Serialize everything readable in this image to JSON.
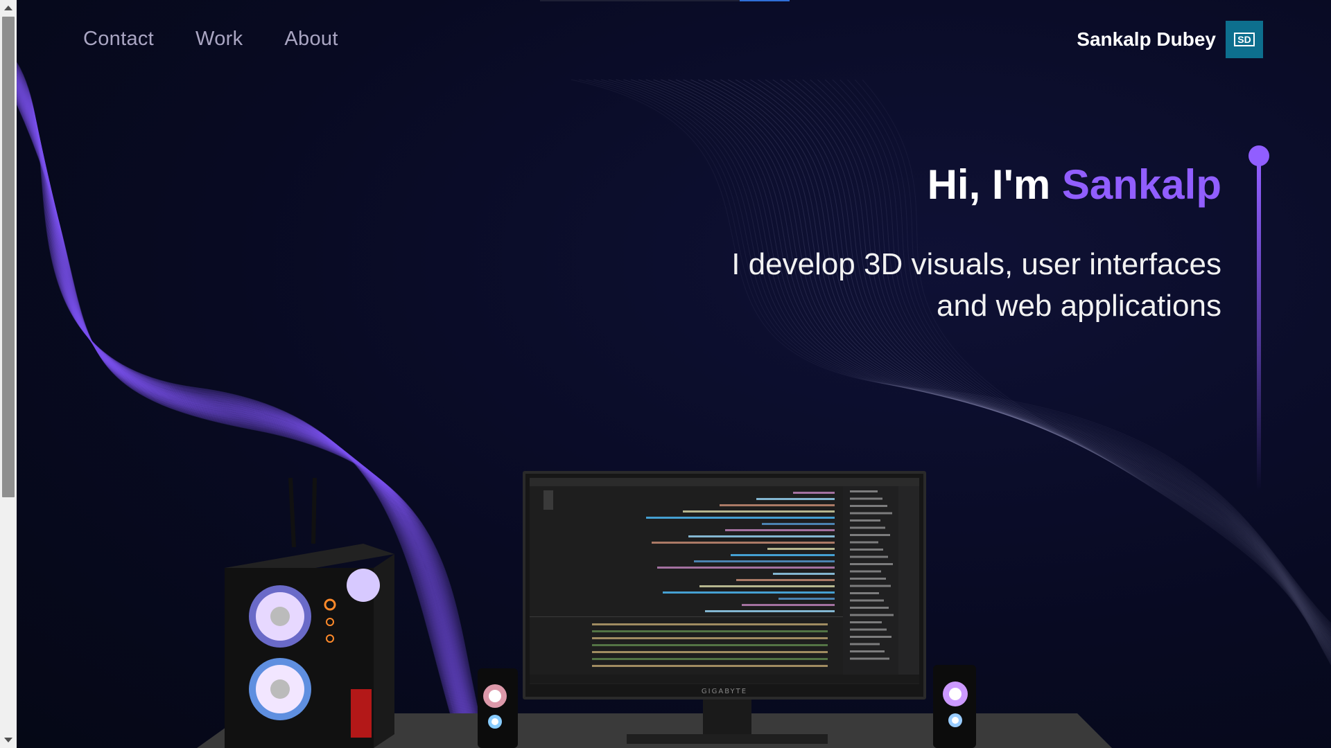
{
  "brand": {
    "name": "Sankalp Dubey",
    "logo_text": "SD"
  },
  "nav": {
    "links": [
      "About",
      "Work",
      "Contact"
    ]
  },
  "hero": {
    "greeting": "Hi, I'm ",
    "name": "Sankalp",
    "subtitle": "I develop 3D visuals, user interfaces and web applications"
  },
  "colors": {
    "background": "#050816",
    "accent": "#915eff",
    "logo_bg": "#0d6f8e",
    "nav_text": "#aaa6c3"
  },
  "scene": {
    "monitor_brand": "GIGABYTE"
  }
}
